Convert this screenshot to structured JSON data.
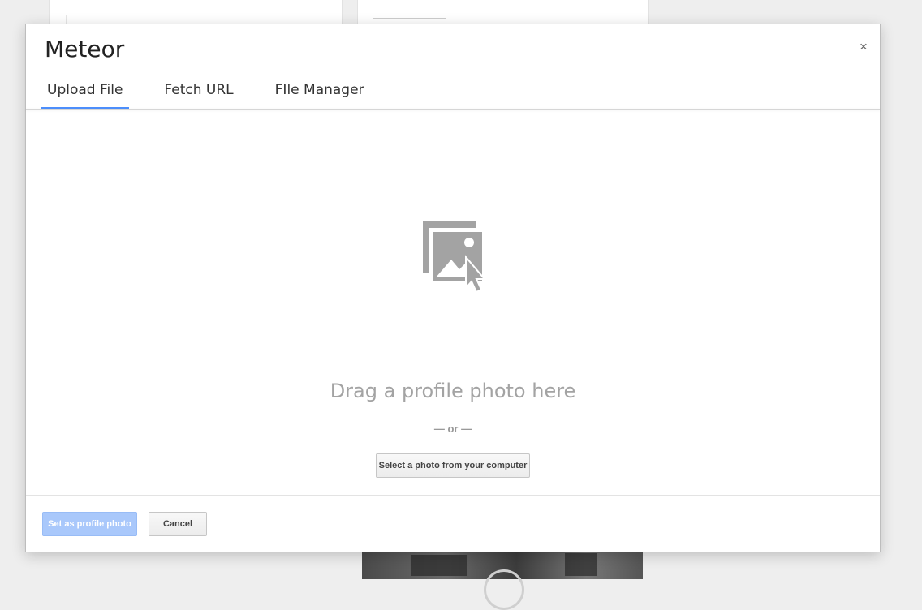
{
  "dialog": {
    "title": "Meteor",
    "close_label": "×"
  },
  "tabs": [
    {
      "label": "Upload File",
      "active": true
    },
    {
      "label": "Fetch URL",
      "active": false
    },
    {
      "label": "FIle Manager",
      "active": false
    }
  ],
  "dropzone": {
    "icon": "photo-upload-icon",
    "drag_text": "Drag a profile photo here",
    "or_text": "— or —",
    "select_button_label": "Select a photo from your computer"
  },
  "footer": {
    "set_button_label": "Set as profile photo",
    "cancel_button_label": "Cancel"
  },
  "colors": {
    "accent": "#4d90fe",
    "primary_disabled": "#a9c8fb",
    "icon_gray": "#a3a3a3"
  }
}
